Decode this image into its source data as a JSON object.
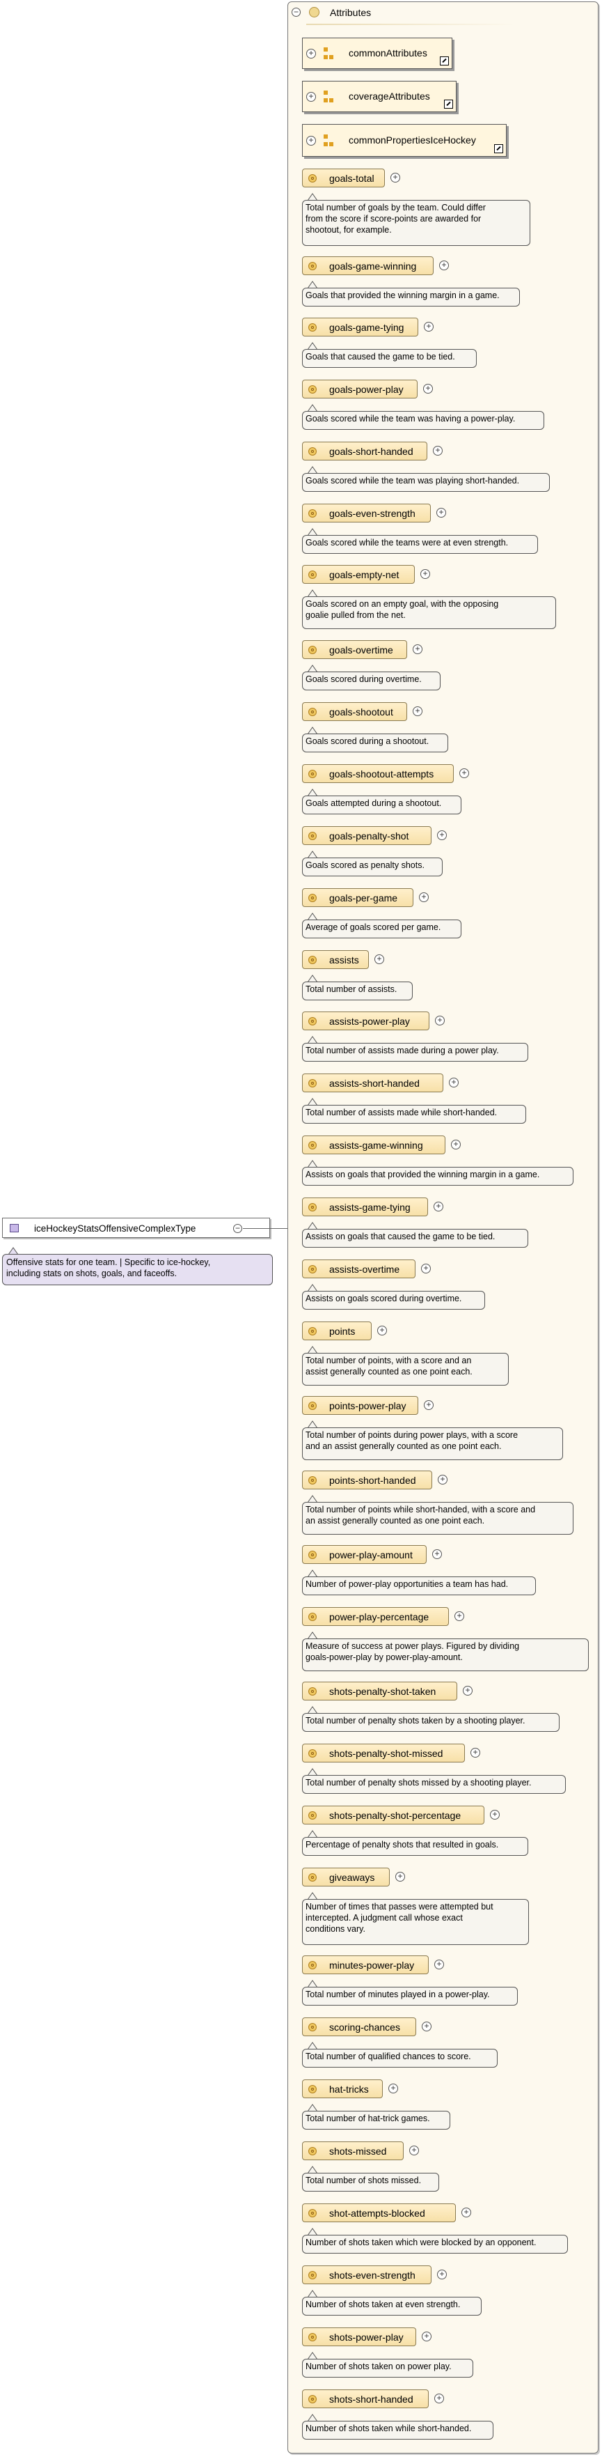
{
  "complex_type": {
    "name": "iceHockeyStatsOffensiveComplexType",
    "doc": "Offensive stats for one team. | Specific to ice-hockey,\nincluding stats on shots, goals, and faceoffs."
  },
  "attributes_group": {
    "title": "Attributes",
    "groups": [
      {
        "label": "commonAttributes"
      },
      {
        "label": "coverageAttributes"
      },
      {
        "label": "commonPropertiesIceHockey"
      }
    ]
  },
  "attributes": [
    {
      "name": "goals-total",
      "doc": "Total number of goals by the team. Could differ\nfrom the score if score-points are awarded for\nshootout, for example."
    },
    {
      "name": "goals-game-winning",
      "doc": "Goals that provided the winning margin in a game."
    },
    {
      "name": "goals-game-tying",
      "doc": "Goals that caused the game to be tied."
    },
    {
      "name": "goals-power-play",
      "doc": "Goals scored while the team was having a power-play."
    },
    {
      "name": "goals-short-handed",
      "doc": "Goals scored while the team was playing short-handed."
    },
    {
      "name": "goals-even-strength",
      "doc": "Goals scored while the teams were at even strength."
    },
    {
      "name": "goals-empty-net",
      "doc": "Goals scored on an empty goal, with the opposing\ngoalie pulled from the net."
    },
    {
      "name": "goals-overtime",
      "doc": "Goals scored during overtime."
    },
    {
      "name": "goals-shootout",
      "doc": "Goals scored during a shootout."
    },
    {
      "name": "goals-shootout-attempts",
      "doc": "Goals attempted during a shootout."
    },
    {
      "name": "goals-penalty-shot",
      "doc": "Goals scored as penalty shots."
    },
    {
      "name": "goals-per-game",
      "doc": "Average of goals scored per game."
    },
    {
      "name": "assists",
      "doc": "Total number of assists."
    },
    {
      "name": "assists-power-play",
      "doc": "Total number of assists made during a power play."
    },
    {
      "name": "assists-short-handed",
      "doc": "Total number of assists made while short-handed."
    },
    {
      "name": "assists-game-winning",
      "doc": "Assists on goals that provided the winning margin in a game."
    },
    {
      "name": "assists-game-tying",
      "doc": "Assists on goals that caused the game to be tied."
    },
    {
      "name": "assists-overtime",
      "doc": "Assists on goals scored during overtime."
    },
    {
      "name": "points",
      "doc": "Total number of points, with a score and an\nassist generally counted as one point each."
    },
    {
      "name": "points-power-play",
      "doc": "Total number of points during power plays, with a score\nand an assist generally counted as one point each."
    },
    {
      "name": "points-short-handed",
      "doc": "Total number of points while short-handed, with a score and\nan assist generally counted as one point each."
    },
    {
      "name": "power-play-amount",
      "doc": "Number of power-play opportunities a team has had."
    },
    {
      "name": "power-play-percentage",
      "doc": "Measure of success at power plays. Figured by dividing\ngoals-power-play by power-play-amount."
    },
    {
      "name": "shots-penalty-shot-taken",
      "doc": "Total number of penalty shots taken by a shooting player."
    },
    {
      "name": "shots-penalty-shot-missed",
      "doc": "Total number of penalty shots missed by a shooting player."
    },
    {
      "name": "shots-penalty-shot-percentage",
      "doc": "Percentage of penalty shots that resulted in goals."
    },
    {
      "name": "giveaways",
      "doc": "Number of times that passes were attempted but\nintercepted.  A judgment call whose exact\nconditions vary."
    },
    {
      "name": "minutes-power-play",
      "doc": "Total number of minutes played in a power-play."
    },
    {
      "name": "scoring-chances",
      "doc": "Total number of qualified chances to score."
    },
    {
      "name": "hat-tricks",
      "doc": "Total number of hat-trick games."
    },
    {
      "name": "shots-missed",
      "doc": "Total number of shots missed."
    },
    {
      "name": "shot-attempts-blocked",
      "doc": "Number of shots taken which were blocked by an opponent."
    },
    {
      "name": "shots-even-strength",
      "doc": "Number of shots taken at even strength."
    },
    {
      "name": "shots-power-play",
      "doc": "Number of shots taken on power play."
    },
    {
      "name": "shots-short-handed",
      "doc": "Number of shots taken while short-handed."
    }
  ]
}
